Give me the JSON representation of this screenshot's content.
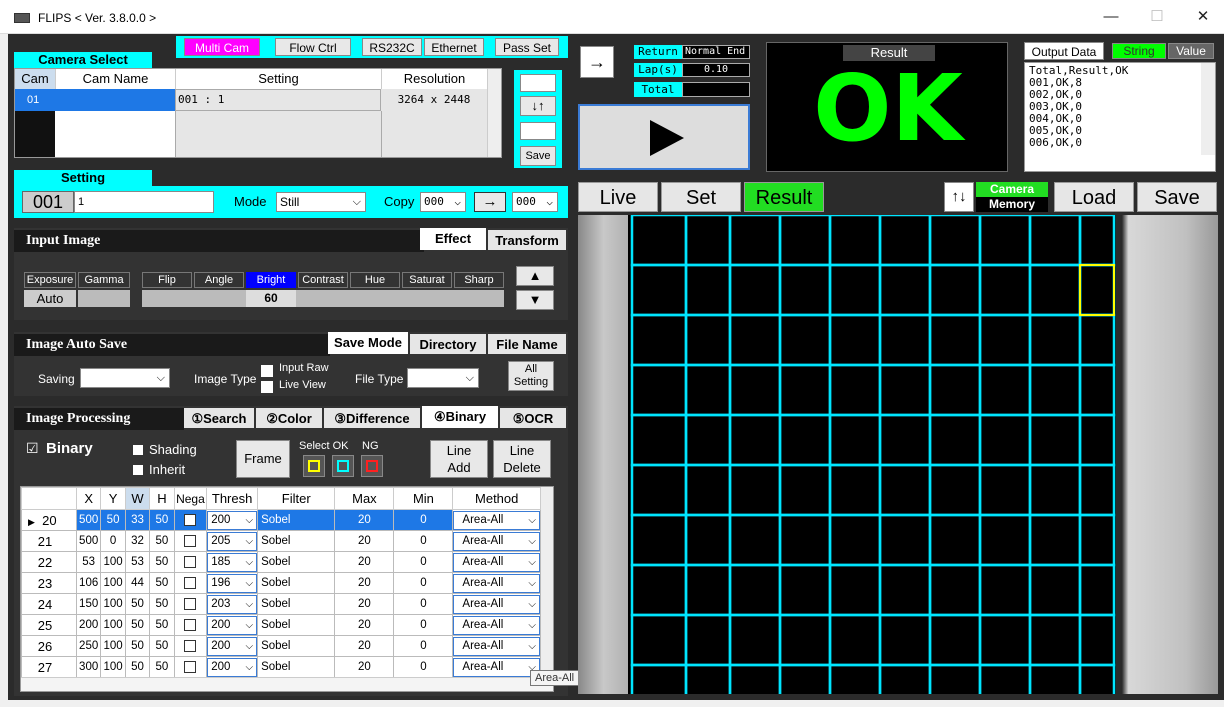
{
  "window": {
    "title": "FLIPS",
    "version": "< Ver. 3.8.0.0 >",
    "min": "—",
    "max": "☐",
    "close": "✕"
  },
  "topbar": {
    "multi_cam": "Multi Cam",
    "flow_ctrl": "Flow Ctrl",
    "rs232c": "RS232C",
    "ethernet": "Ethernet",
    "pass_set": "Pass Set"
  },
  "camera_select": {
    "title": "Camera Select",
    "headers": [
      "Cam",
      "Cam Name",
      "Setting",
      "Resolution"
    ],
    "rows": [
      {
        "cam": "01",
        "name": "",
        "setting": "001 : 1",
        "resolution": "3264 x 2448"
      },
      {
        "cam": "",
        "name": "",
        "setting": "",
        "resolution": ""
      },
      {
        "cam": "",
        "name": "",
        "setting": "",
        "resolution": ""
      }
    ],
    "swap": "↓↑",
    "save": "Save"
  },
  "setting": {
    "title": "Setting",
    "number": "001",
    "name": "1",
    "mode_label": "Mode",
    "mode_value": "Still",
    "copy_label": "Copy",
    "copy_from": "000",
    "arrow": "→",
    "copy_to": "000"
  },
  "input_image": {
    "title": "Input Image",
    "tabs": [
      "Effect",
      "Transform"
    ],
    "labels": [
      "Exposure",
      "Gamma",
      "Flip",
      "Angle",
      "Bright",
      "Contrast",
      "Hue",
      "Saturat",
      "Sharp"
    ],
    "exposure_value": "Auto",
    "bright_value": "60",
    "up": "▲",
    "down": "▼"
  },
  "auto_save": {
    "title": "Image Auto Save",
    "tabs": [
      "Save Mode",
      "Directory",
      "File Name"
    ],
    "saving_label": "Saving",
    "image_type_label": "Image Type",
    "input_raw": "Input Raw",
    "live_view": "Live View",
    "file_type_label": "File Type",
    "all_setting": [
      "All",
      "Setting"
    ]
  },
  "image_processing": {
    "title": "Image Processing",
    "tabs": [
      "①Search",
      "②Color",
      "③Difference",
      "④Binary",
      "⑤OCR"
    ],
    "binary_label": "Binary",
    "shading": "Shading",
    "inherit": "Inherit",
    "frame": "Frame",
    "select_ok": "Select OK",
    "ng": "NG",
    "line_add": [
      "Line",
      "Add"
    ],
    "line_delete": [
      "Line",
      "Delete"
    ],
    "headers": [
      "X",
      "Y",
      "W",
      "H",
      "Nega",
      "Thresh",
      "Filter",
      "Max",
      "Min",
      "Method"
    ],
    "rows": [
      {
        "id": "20",
        "x": "500",
        "y": "50",
        "w": "33",
        "h": "50",
        "thresh": "200",
        "filter": "Sobel",
        "max": "20",
        "min": "0",
        "method": "Area-All"
      },
      {
        "id": "21",
        "x": "500",
        "y": "0",
        "w": "32",
        "h": "50",
        "thresh": "205",
        "filter": "Sobel",
        "max": "20",
        "min": "0",
        "method": "Area-All"
      },
      {
        "id": "22",
        "x": "53",
        "y": "100",
        "w": "53",
        "h": "50",
        "thresh": "185",
        "filter": "Sobel",
        "max": "20",
        "min": "0",
        "method": "Area-All"
      },
      {
        "id": "23",
        "x": "106",
        "y": "100",
        "w": "44",
        "h": "50",
        "thresh": "196",
        "filter": "Sobel",
        "max": "20",
        "min": "0",
        "method": "Area-All"
      },
      {
        "id": "24",
        "x": "150",
        "y": "100",
        "w": "50",
        "h": "50",
        "thresh": "203",
        "filter": "Sobel",
        "max": "20",
        "min": "0",
        "method": "Area-All"
      },
      {
        "id": "25",
        "x": "200",
        "y": "100",
        "w": "50",
        "h": "50",
        "thresh": "200",
        "filter": "Sobel",
        "max": "20",
        "min": "0",
        "method": "Area-All"
      },
      {
        "id": "26",
        "x": "250",
        "y": "100",
        "w": "50",
        "h": "50",
        "thresh": "200",
        "filter": "Sobel",
        "max": "20",
        "min": "0",
        "method": "Area-All"
      },
      {
        "id": "27",
        "x": "300",
        "y": "100",
        "w": "50",
        "h": "50",
        "thresh": "200",
        "filter": "Sobel",
        "max": "20",
        "min": "0",
        "method": "Area-All"
      }
    ],
    "tooltip": "Area-All"
  },
  "status": {
    "return_label": "Return",
    "return_value": "Normal End",
    "lap_label": "Lap(s)",
    "lap_value": "0.10",
    "total_label": "Total",
    "total_value": "",
    "arrow": "→"
  },
  "result": {
    "label": "Result",
    "value": "OK"
  },
  "output": {
    "title": "Output Data",
    "string": "String",
    "value": "Value",
    "lines": [
      "Total,Result,OK",
      "001,OK,8",
      "002,OK,0",
      "003,OK,0",
      "004,OK,0",
      "005,OK,0",
      "006,OK,0"
    ]
  },
  "view_tabs": {
    "live": "Live",
    "set": "Set",
    "result": "Result",
    "sort": "↑↓",
    "camera": "Camera",
    "memory": "Memory",
    "load": "Load",
    "save": "Save"
  },
  "colors": {
    "accent_cyan": "#00ffff",
    "ok_green": "#00ff00",
    "result_green": "#22dd22",
    "magenta": "#ff00ff",
    "select_blue": "#1e78e6"
  }
}
